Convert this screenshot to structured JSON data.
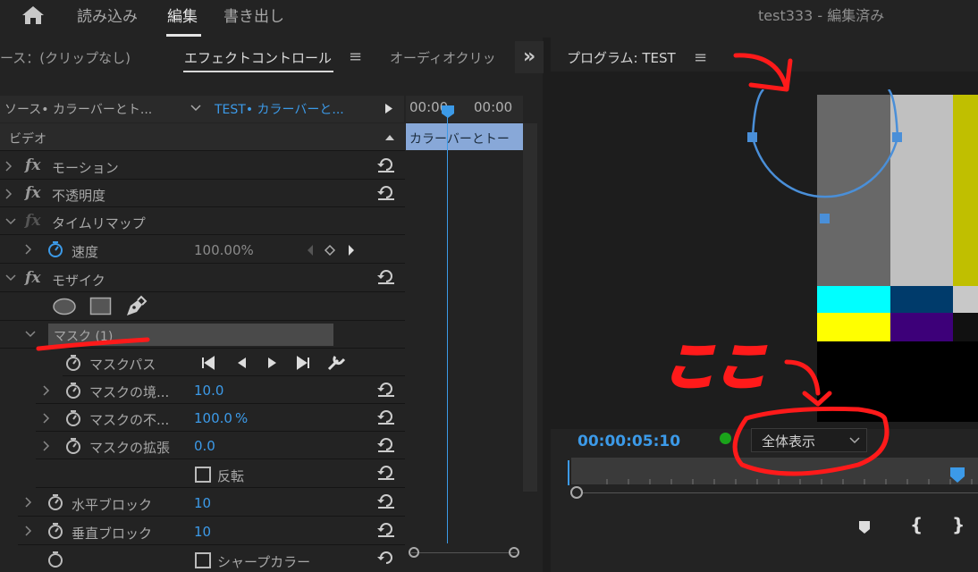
{
  "topbar": {
    "tabs": [
      "読み込み",
      "編集",
      "書き出し"
    ],
    "project_title": "test333 - 編集済み"
  },
  "left_panel": {
    "tabs": {
      "source": "ース：(クリップなし)",
      "effect_controls": "エフェクトコントロール",
      "audio": "オーディオクリッ"
    },
    "menu_glyph": "≡",
    "overflow": "»",
    "source_clip": "ソース• カラーバーとト...",
    "target_clip": "TEST• カラーバーと...",
    "timecode_a": "00:00",
    "timecode_b": "00:00",
    "clip_bar_label": "カラーバーとトー",
    "section_video": "ビデオ",
    "effects": {
      "motion": "モーション",
      "opacity": "不透明度",
      "time_remap": "タイムリマップ",
      "speed_label": "速度",
      "speed_value": "100.00%",
      "mosaic": "モザイク",
      "mask_name": "マスク (1)",
      "mask_path": "マスクパス",
      "mask_feather": "マスクの境...",
      "mask_feather_value": "10.0",
      "mask_opacity": "マスクの不...",
      "mask_opacity_value": "100.0",
      "mask_opacity_unit": "%",
      "mask_expansion": "マスクの拡張",
      "mask_expansion_value": "0.0",
      "invert": "反転",
      "horizontal_blocks": "水平ブロック",
      "horizontal_blocks_value": "10",
      "vertical_blocks": "垂直ブロック",
      "vertical_blocks_value": "10",
      "sharp_color": "シャープカラー"
    },
    "fx_glyph": "fx"
  },
  "program": {
    "title": "プログラム: TEST",
    "menu_glyph": "≡",
    "timecode": "00:00:05:10",
    "zoom_select": "全体表示"
  },
  "annotation": {
    "text": "ここ"
  },
  "colors": {
    "accent": "#3c9ae8",
    "annotation": "#ff1a1a",
    "panel_bg": "#232323"
  },
  "colorbars": [
    "#686868",
    "#c0c0c0",
    "#c0bf00",
    "#00ffff",
    "#003b6b",
    "#ffff00",
    "#3d0079",
    "#000000"
  ]
}
